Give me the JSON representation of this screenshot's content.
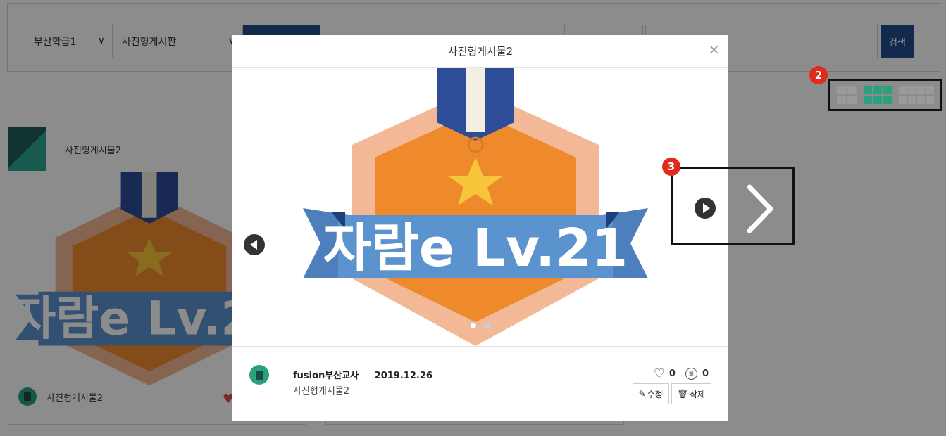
{
  "filters": {
    "class_select": "부산학급1",
    "board_select": "사진형게시판",
    "search_button": "검색"
  },
  "card": {
    "title": "사진형게시물2",
    "footer_title": "사진형게시물2"
  },
  "modal": {
    "title": "사진형게시물2",
    "close": "×",
    "image_text": "자람e Lv.21",
    "author": "fusion부산교사",
    "date": "2019.12.26",
    "caption": "사진형게시물2",
    "likes": "0",
    "comments": "0",
    "edit_label": "수정",
    "delete_label": "삭제",
    "slide_count": 2,
    "active_slide": 1
  },
  "annotations": {
    "badge_view": "2",
    "badge_next": "3"
  },
  "colors": {
    "brand_blue": "#1f4e8c",
    "accent_green": "#2aa07f",
    "badge_red": "#e02a1c",
    "badge_orange": "#ee8a2c",
    "ribbon_blue": "#5b93cf"
  }
}
